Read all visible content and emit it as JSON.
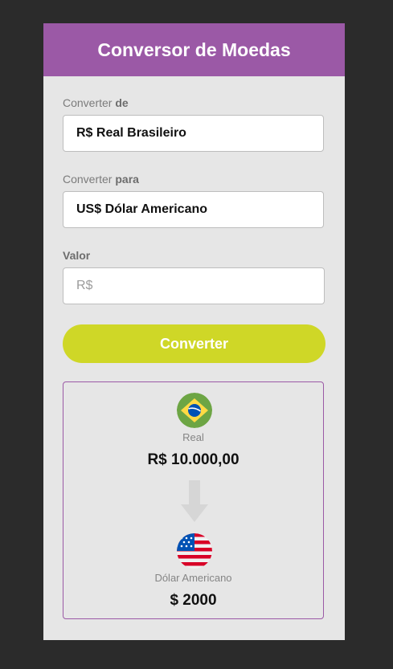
{
  "header": {
    "title": "Conversor de Moedas"
  },
  "form": {
    "from_label_prefix": "Converter",
    "from_label_bold": "de",
    "from_selected": "R$ Real Brasileiro",
    "to_label_prefix": "Converter",
    "to_label_bold": "para",
    "to_selected": "US$ Dólar Americano",
    "value_label": "Valor",
    "value_placeholder": "R$",
    "value_input": "",
    "convert_button": "Converter"
  },
  "result": {
    "from_currency_name": "Real",
    "from_amount": "R$ 10.000,00",
    "to_currency_name": "Dólar Americano",
    "to_amount": "$ 2000"
  },
  "colors": {
    "header": "#9b59a6",
    "button": "#cfd727",
    "panel": "#e6e6e6",
    "page_background": "#2b2b2b"
  },
  "icons": {
    "from_flag": "brazil-flag-icon",
    "arrow": "arrow-down-icon",
    "to_flag": "usa-flag-icon"
  }
}
